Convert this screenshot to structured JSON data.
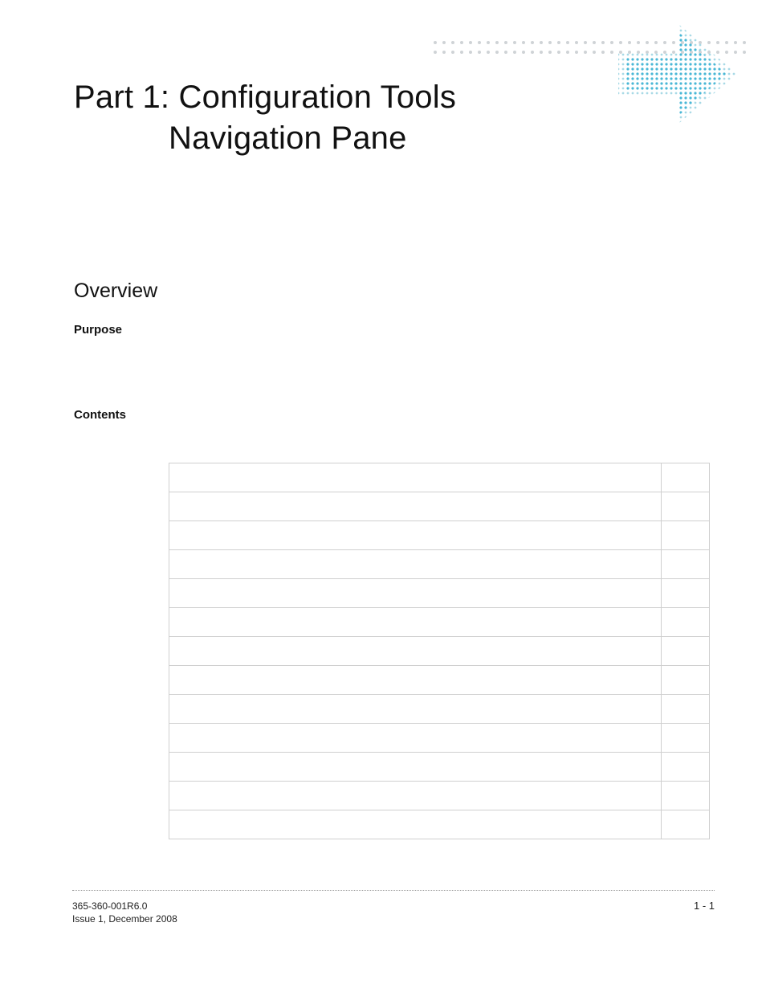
{
  "title": {
    "line1": "Part 1:  Configuration Tools",
    "line2": "Navigation Pane"
  },
  "sections": {
    "overview": "Overview",
    "purpose": "Purpose",
    "contents": "Contents"
  },
  "contents_table": {
    "rows": [
      {
        "title": "",
        "page": ""
      },
      {
        "title": "",
        "page": ""
      },
      {
        "title": "",
        "page": ""
      },
      {
        "title": "",
        "page": ""
      },
      {
        "title": "",
        "page": ""
      },
      {
        "title": "",
        "page": ""
      },
      {
        "title": "",
        "page": ""
      },
      {
        "title": "",
        "page": ""
      },
      {
        "title": "",
        "page": ""
      },
      {
        "title": "",
        "page": ""
      },
      {
        "title": "",
        "page": ""
      },
      {
        "title": "",
        "page": ""
      },
      {
        "title": "",
        "page": ""
      }
    ]
  },
  "footer": {
    "doc_id": "365-360-001R6.0",
    "issue_line": "Issue 1,   December 2008",
    "page_number": "1 - 1"
  }
}
